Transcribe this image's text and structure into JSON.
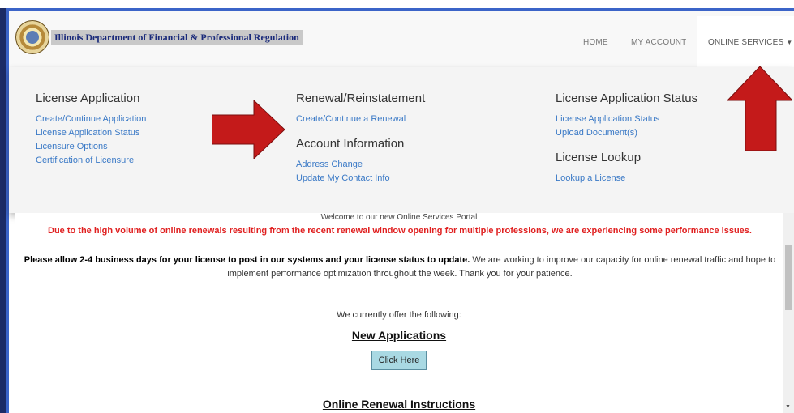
{
  "header": {
    "brand": "Illinois Department of Financial & Professional Regulation",
    "nav": {
      "home": "HOME",
      "my_account": "MY ACCOUNT",
      "online_services": "ONLINE SERVICES"
    }
  },
  "menu": {
    "license_application": {
      "title": "License Application",
      "links": [
        "Create/Continue Application",
        "License Application Status",
        "Licensure Options",
        "Certification of Licensure"
      ]
    },
    "renewal": {
      "title": "Renewal/Reinstatement",
      "links": [
        "Create/Continue a Renewal"
      ]
    },
    "account_information": {
      "title": "Account Information",
      "links": [
        "Address Change",
        "Update My Contact Info"
      ]
    },
    "license_application_status": {
      "title": "License Application Status",
      "links": [
        "License Application Status",
        "Upload Document(s)"
      ]
    },
    "license_lookup": {
      "title": "License Lookup",
      "links": [
        "Lookup a License"
      ]
    }
  },
  "content": {
    "welcome": "Welcome to our new Online Services Portal",
    "alert": "Due to the high volume of online renewals resulting from the recent renewal window opening for multiple professions, we are experiencing some performance issues.",
    "note_bold": "Please allow 2-4 business days for your license to post in our systems and your license status to update.",
    "note_rest": " We are working to improve our capacity for online renewal traffic and hope to implement performance optimization throughout the week. Thank you for your patience.",
    "offer": "We currently offer the following:",
    "new_applications": "New Applications",
    "click_here": "Click Here",
    "renewal_instructions": "Online Renewal Instructions"
  },
  "colors": {
    "link": "#3a79c6",
    "alert": "#e02020",
    "arrow": "#c41a1a",
    "button": "#a9d9e3"
  }
}
